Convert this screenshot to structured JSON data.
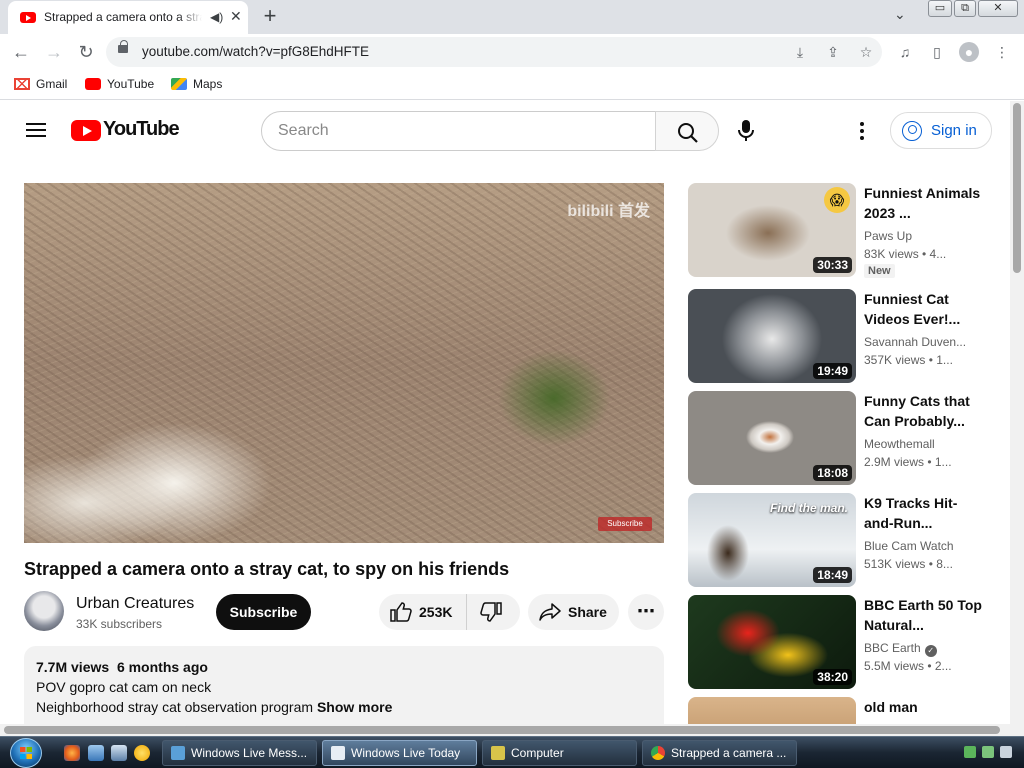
{
  "browser": {
    "tab_title": "Strapped a camera onto a stray cat, to spy on his friends",
    "url": "youtube.com/watch?v=pfG8EhdHFTE",
    "window_buttons": [
      "▭",
      "⧉",
      "✕"
    ],
    "bookmarks": [
      {
        "label": "Gmail",
        "icon": "gmail-icon"
      },
      {
        "label": "YouTube",
        "icon": "youtube-icon"
      },
      {
        "label": "Maps",
        "icon": "maps-icon"
      }
    ]
  },
  "header": {
    "logo_text": "YouTube",
    "search_placeholder": "Search",
    "sign_in": "Sign in"
  },
  "video": {
    "title": "Strapped a camera onto a stray cat, to spy on his friends",
    "player_watermark": "bilibili 首发",
    "player_subscribe_tag": "Subscribe",
    "channel": "Urban Creatures",
    "subscribers": "33K subscribers",
    "subscribe_label": "Subscribe",
    "likes": "253K",
    "share_label": "Share",
    "views": "7.7M views",
    "age": "6 months ago",
    "desc_line1": "POV gopro cat cam on neck",
    "desc_line2": "Neighborhood stray cat observation program",
    "show_more": "Show more"
  },
  "recommendations": [
    {
      "title": "Funniest Animals 2023 ...",
      "channel": "Paws Up",
      "meta": "83K views  • 4...",
      "duration": "30:33",
      "badge": "New",
      "verified": false,
      "thumb": [
        "#d9d3cb",
        "#8a6f55"
      ]
    },
    {
      "title": "Funniest Cat Videos Ever!...",
      "channel": "Savannah Duven...",
      "meta": "357K views  • 1...",
      "duration": "19:49",
      "badge": "",
      "verified": false,
      "thumb": [
        "#c7c9cc",
        "#5c6166"
      ]
    },
    {
      "title": "Funny Cats that Can Probably...",
      "channel": "Meowthemall",
      "meta": "2.9M views  • 1...",
      "duration": "18:08",
      "badge": "",
      "verified": false,
      "thumb": [
        "#e8e5e1",
        "#b8734a"
      ]
    },
    {
      "title": "K9 Tracks Hit-and-Run...",
      "channel": "Blue Cam Watch",
      "meta": "513K views  • 8...",
      "duration": "18:49",
      "badge": "",
      "verified": false,
      "overlay": "Find the man.",
      "thumb": [
        "#dfe3e6",
        "#4b4f52"
      ]
    },
    {
      "title": "BBC Earth 50 Top Natural...",
      "channel": "BBC Earth",
      "meta": "5.5M views  • 2...",
      "duration": "38:20",
      "badge": "",
      "verified": true,
      "thumb": [
        "#1b2b1a",
        "#e0a01c"
      ]
    },
    {
      "title": "old man",
      "channel": "",
      "meta": "",
      "duration": "",
      "badge": "",
      "verified": false,
      "thumb": [
        "#d9b48a",
        "#a97a4c"
      ]
    }
  ],
  "taskbar": {
    "tasks": [
      {
        "label": "Windows Live Mess...",
        "color": "#5aa0d8"
      },
      {
        "label": "Windows Live Today",
        "color": "#e8eef5"
      },
      {
        "label": "Computer",
        "color": "#d8c44a"
      },
      {
        "label": "Strapped a camera ...",
        "color": "#e94235"
      }
    ]
  }
}
